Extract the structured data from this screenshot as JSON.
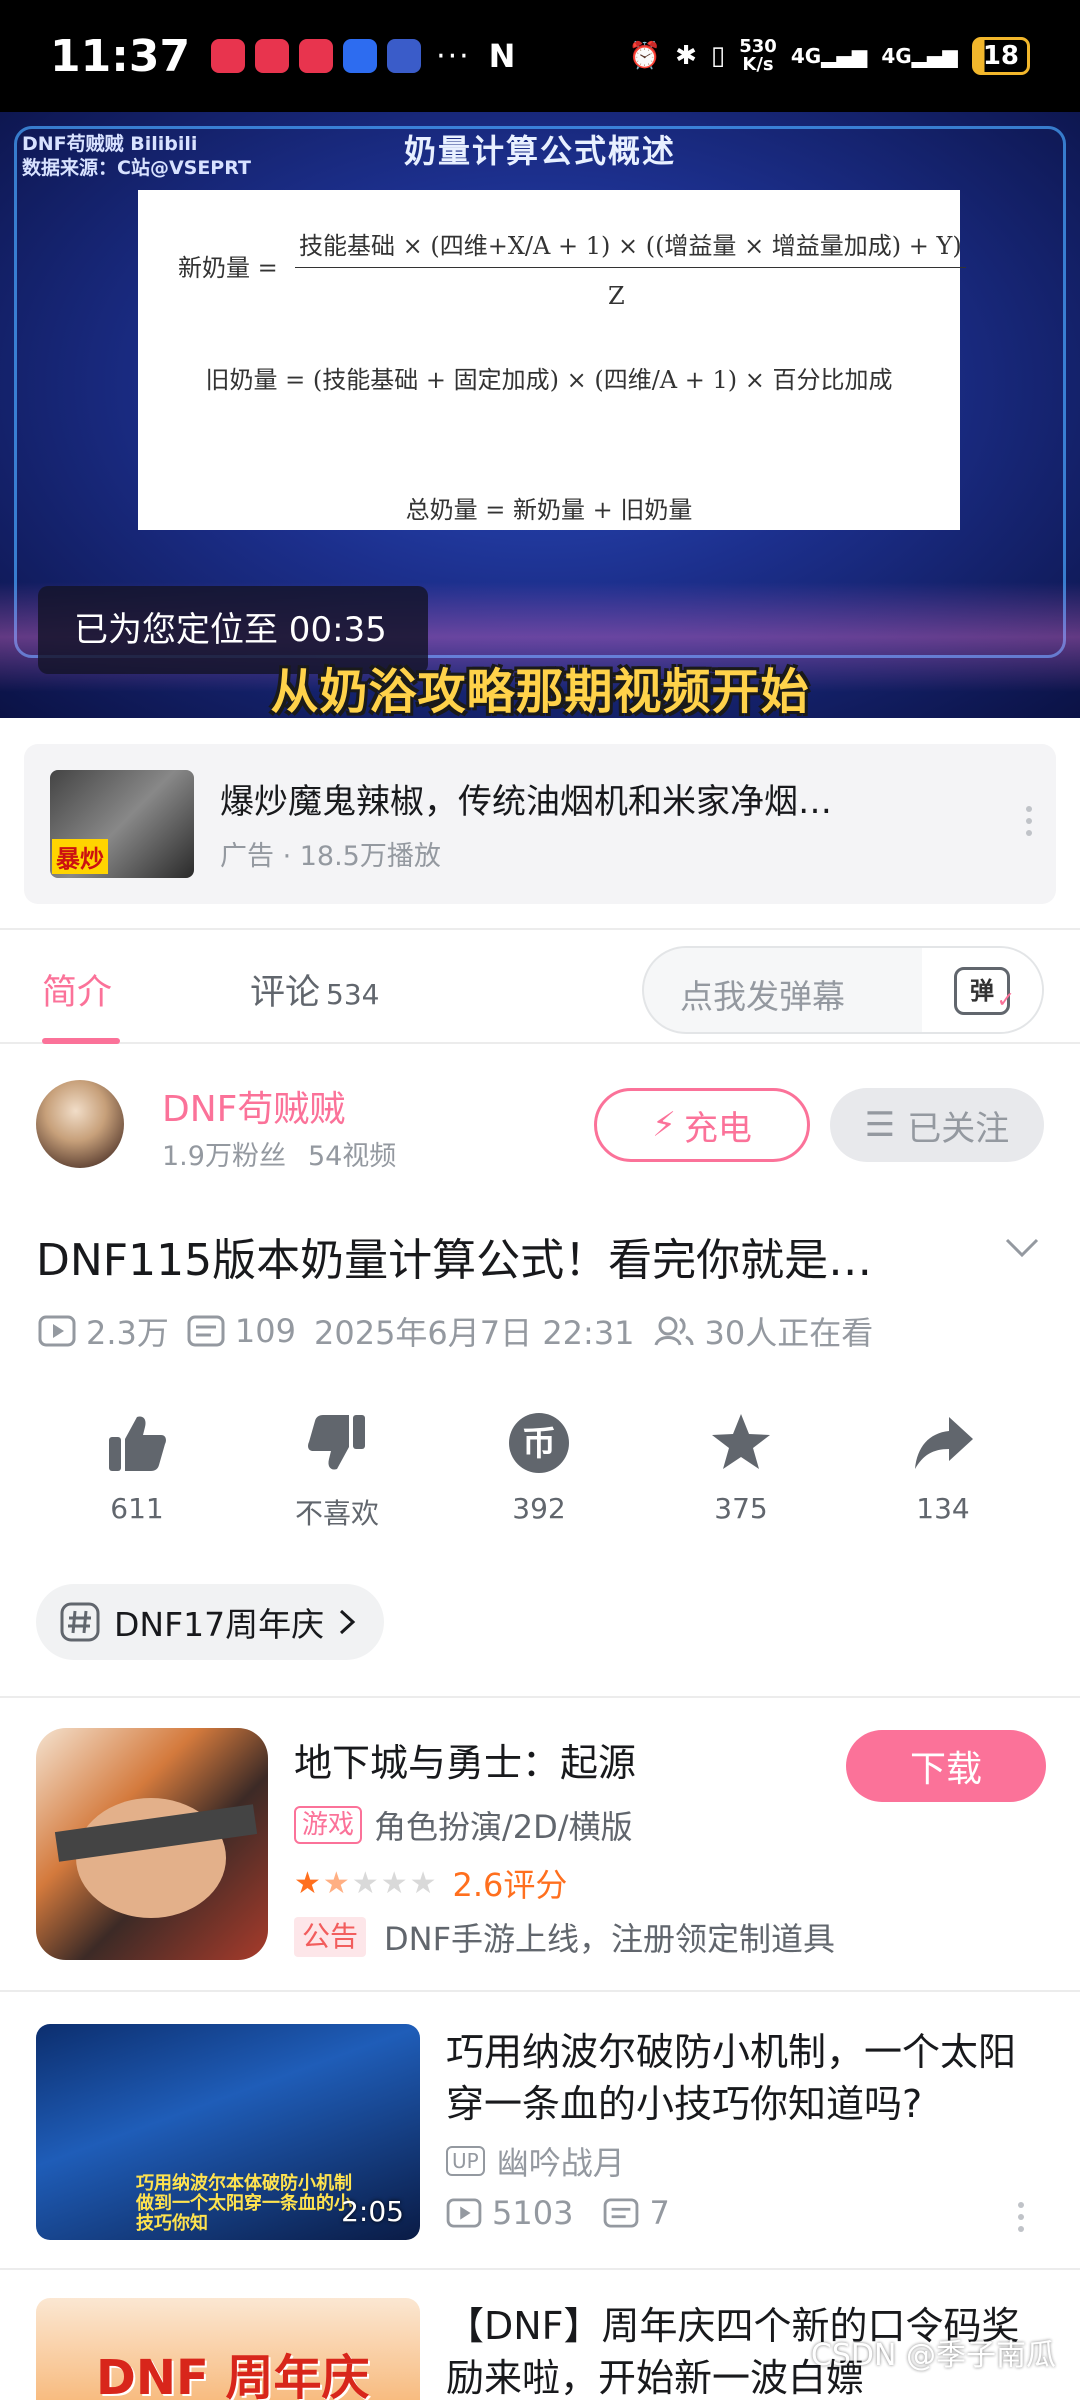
{
  "status_bar": {
    "time": "11:37",
    "more": "···",
    "network_speed_value": "530",
    "network_speed_unit": "K/s",
    "signal_1": "4G",
    "signal_2": "4G",
    "battery": "18"
  },
  "player": {
    "watermark_line1": "DNF苟贼贼  Bilibili",
    "watermark_line2": "数据来源：C站@VSEPRT",
    "slide_title": "奶量计算公式概述",
    "formula_new_lhs": "新奶量 =",
    "formula_new_numerator": "技能基础 × (四维+X/A + 1) × ((增益量 × 增益量加成) + Y)",
    "formula_new_denominator": "Z",
    "formula_old": "旧奶量 = (技能基础 + 固定加成) × (四维/A + 1) × 百分比加成",
    "formula_total": "总奶量 = 新奶量 + 旧奶量",
    "toast": "已为您定位至 00:35",
    "subtitle": "从奶浴攻略那期视频开始"
  },
  "ad": {
    "thumb_tag": "暴炒",
    "title": "爆炒魔鬼辣椒，传统油烟机和米家净烟…",
    "meta": "广告 · 18.5万播放"
  },
  "tabs": {
    "intro": "简介",
    "comments": "评论",
    "comments_count": "534",
    "danmaku_placeholder": "点我发弹幕",
    "danmaku_button": "弹"
  },
  "uploader": {
    "name": "DNF苟贼贼",
    "fans": "1.9万粉丝",
    "videos": "54视频",
    "charge": "充电",
    "follow": "已关注"
  },
  "video": {
    "title": "DNF115版本奶量计算公式！看完你就是…",
    "views": "2.3万",
    "danmaku_count": "109",
    "date": "2025年6月7日 22:31",
    "watching": "30人正在看"
  },
  "actions": {
    "like": "611",
    "dislike": "不喜欢",
    "coin": "392",
    "favorite": "375",
    "share": "134"
  },
  "tag": {
    "label": "DNF17周年庆"
  },
  "game": {
    "title": "地下城与勇士：起源",
    "badge": "游戏",
    "genre": "角色扮演/2D/横版",
    "rating_value": 2.6,
    "rating": "2.6评分",
    "notice_badge": "公告",
    "notice": "DNF手游上线，注册领定制道具",
    "download": "下载"
  },
  "recommendations": [
    {
      "thumb_caption": "巧用纳波尔本体破防小机制 做到一个太阳穿一条血的小技巧你知",
      "duration": "2:05",
      "title": "巧用纳波尔破防小机制，一个太阳穿一条血的小技巧你知道吗?",
      "up_badge": "UP",
      "author": "幽吟战月",
      "views": "5103",
      "danmaku": "7"
    },
    {
      "thumb_caption": "DNF 周年庆",
      "title": "【DNF】周年庆四个新的口令码奖励来啦，开始新一波白嫖"
    }
  ],
  "footer_watermark": "CSDN @季子南瓜",
  "colors": {
    "brand_pink": "#fb7299",
    "rating_orange": "#ff6f1e",
    "text_gray": "#9499a0"
  }
}
